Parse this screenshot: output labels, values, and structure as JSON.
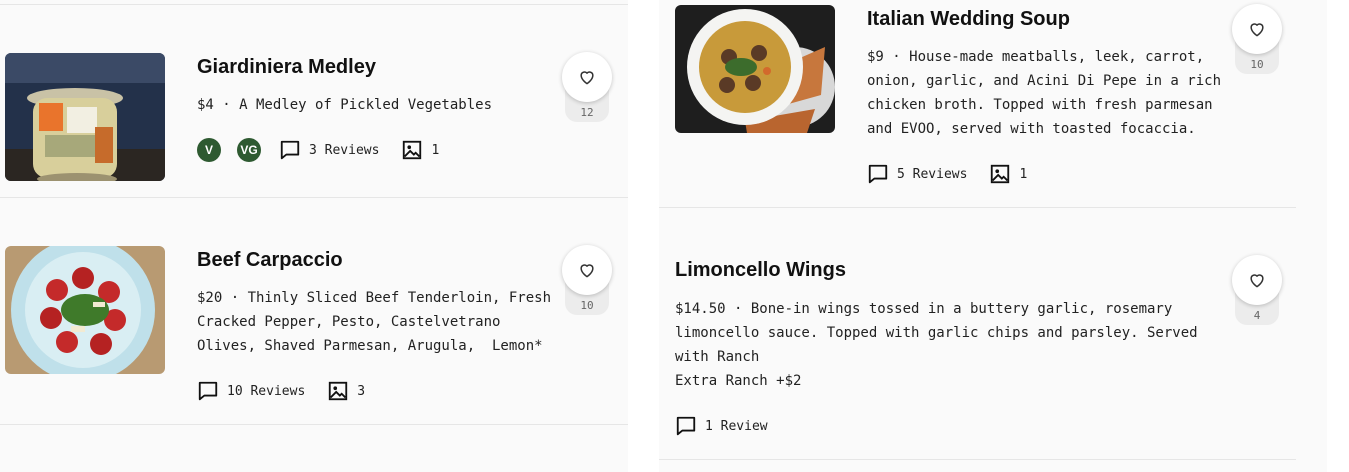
{
  "colors": {
    "badge_green": "#2e5a31",
    "panel_bg": "#fafafa",
    "divider": "#e6e6e6"
  },
  "menu_items": [
    {
      "title": "Giardiniera Medley",
      "description_lines": [
        "$4 · A Medley of Pickled Vegetables"
      ],
      "badges": [
        "V",
        "VG"
      ],
      "reviews_label": "3 Reviews",
      "photos_count": "1",
      "favorites_count": "12",
      "image": "pickled-vegetables-jar"
    },
    {
      "title": "Beef Carpaccio",
      "description_lines": [
        "$20 · Thinly Sliced Beef Tenderloin, Fresh",
        "Cracked Pepper, Pesto, Castelvetrano",
        "Olives, Shaved Parmesan, Arugula,  Lemon*"
      ],
      "badges": [],
      "reviews_label": "10 Reviews",
      "photos_count": "3",
      "favorites_count": "10",
      "image": "beef-carpaccio-plate"
    },
    {
      "title": "Italian Wedding Soup",
      "description_lines": [
        "$9 · House-made meatballs, leek, carrot,",
        "onion, garlic, and Acini Di Pepe in a rich",
        "chicken broth. Topped with fresh parmesan",
        "and EVOO, served with toasted focaccia."
      ],
      "badges": [],
      "reviews_label": "5 Reviews",
      "photos_count": "1",
      "favorites_count": "10",
      "image": "wedding-soup-bowl"
    },
    {
      "title": "Limoncello Wings",
      "description_lines": [
        "$14.50 · Bone-in wings tossed in a buttery garlic, rosemary",
        "limoncello sauce. Topped with garlic chips and parsley. Served",
        "with Ranch",
        "Extra Ranch +$2"
      ],
      "badges": [],
      "reviews_label": "1 Review",
      "favorites_count": "4"
    }
  ]
}
